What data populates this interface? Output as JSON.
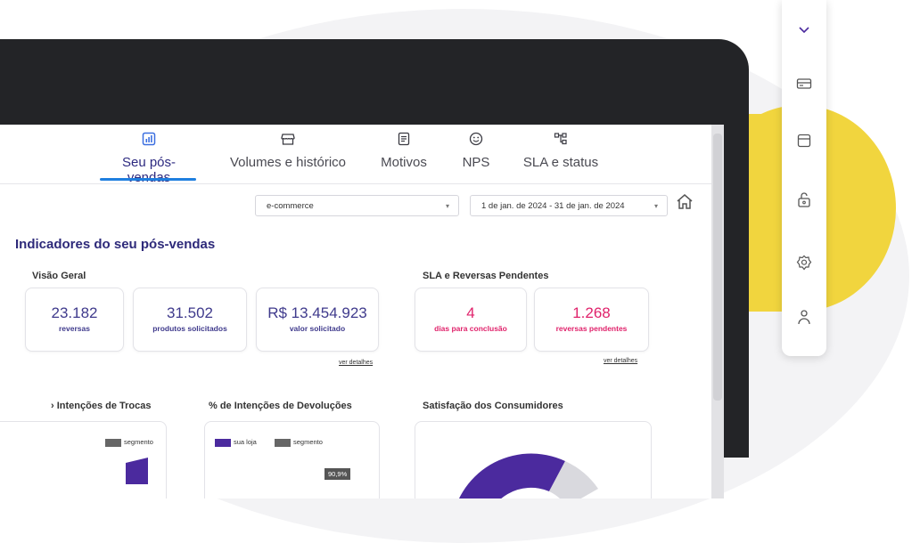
{
  "tabs": [
    {
      "label": "Seu pós-vendas",
      "icon": "dashboard-icon",
      "active": true
    },
    {
      "label": "Volumes e histórico",
      "icon": "store-icon",
      "active": false
    },
    {
      "label": "Motivos",
      "icon": "document-icon",
      "active": false
    },
    {
      "label": "NPS",
      "icon": "smiley-icon",
      "active": false
    },
    {
      "label": "SLA e status",
      "icon": "hierarchy-icon",
      "active": false
    }
  ],
  "filters": {
    "channel": "e-commerce",
    "date_range": "1 de jan. de 2024 - 31 de jan. de 2024"
  },
  "page_title": "Indicadores do seu pós-vendas",
  "overview": {
    "title": "Visão Geral",
    "cards": [
      {
        "value": "23.182",
        "label": "reversas"
      },
      {
        "value": "31.502",
        "label": "produtos solicitados"
      },
      {
        "value": "R$ 13.454.923",
        "label": "valor solicitado"
      }
    ],
    "details_link": "ver detalhes"
  },
  "sla": {
    "title": "SLA e Reversas Pendentes",
    "cards": [
      {
        "value": "4",
        "label": "dias para conclusão"
      },
      {
        "value": "1.268",
        "label": "reversas pendentes"
      }
    ],
    "details_link": "ver detalhes"
  },
  "charts": {
    "trocas_title": "› Intenções de Trocas",
    "devolucoes_title": "% de Intenções de Devoluções",
    "satisfacao_title": "Satisfação dos Consumidores",
    "legend_segment": "segmento",
    "legend_store": "sua loja",
    "badge": "90,9%"
  },
  "colors": {
    "primary": "#2e2a7a",
    "accent_blue": "#1f7fdf",
    "pink": "#e0226b",
    "purple": "#4b2a9e",
    "yellow": "#f1d53e"
  },
  "sidenav_icons": [
    "chevron-down-icon",
    "card-icon",
    "box-icon",
    "unlock-icon",
    "gear-icon",
    "user-icon"
  ]
}
